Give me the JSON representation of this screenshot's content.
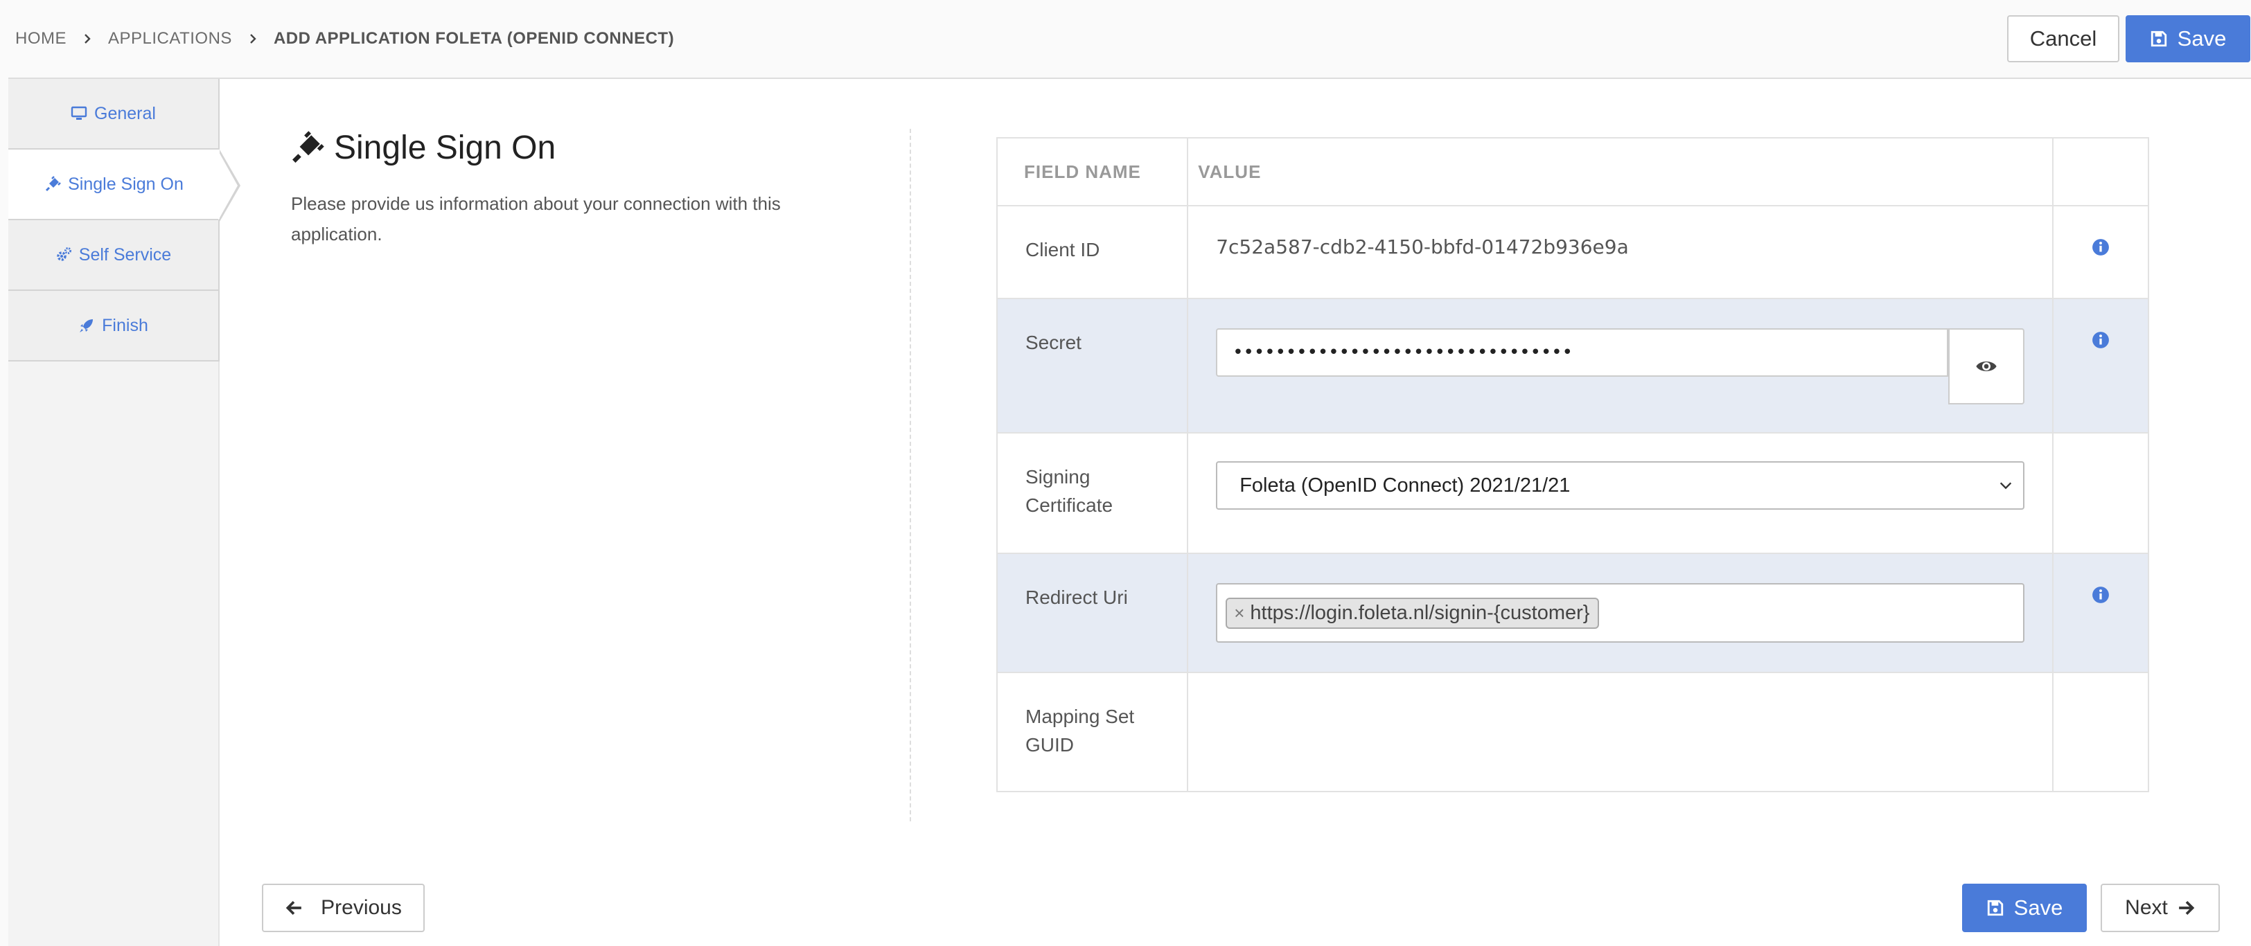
{
  "breadcrumb": {
    "items": [
      "HOME",
      "APPLICATIONS",
      "ADD APPLICATION FOLETA (OPENID CONNECT)"
    ]
  },
  "header": {
    "cancel_label": "Cancel",
    "save_label": "Save"
  },
  "sidebar": {
    "tabs": [
      {
        "label": "General",
        "icon": "desktop-icon"
      },
      {
        "label": "Single Sign On",
        "icon": "plug-icon",
        "active": true
      },
      {
        "label": "Self Service",
        "icon": "gears-icon"
      },
      {
        "label": "Finish",
        "icon": "rocket-icon"
      }
    ]
  },
  "section": {
    "title": "Single Sign On",
    "description": "Please provide us information about your connection with this application."
  },
  "table": {
    "headers": {
      "name": "FIELD NAME",
      "value": "VALUE"
    },
    "rows": {
      "client_id": {
        "name": "Client ID",
        "value": "7c52a587-cdb2-4150-bbfd-01472b936e9a"
      },
      "secret": {
        "name": "Secret",
        "value": "••••••••••••••••••••••••••••••••"
      },
      "signing_certificate": {
        "name": "Signing Certificate",
        "value": "Foleta (OpenID Connect) 2021/21/21"
      },
      "redirect_uri": {
        "name": "Redirect Uri",
        "tag": "https://login.foleta.nl/signin-{customer}",
        "tag_remove": "×"
      },
      "mapping_set_guid": {
        "name": "Mapping Set GUID"
      }
    }
  },
  "footer": {
    "previous_label": "Previous",
    "save_label": "Save",
    "next_label": "Next"
  },
  "colors": {
    "accent": "#4a7bd9",
    "row_shade": "#e6ebf4"
  }
}
